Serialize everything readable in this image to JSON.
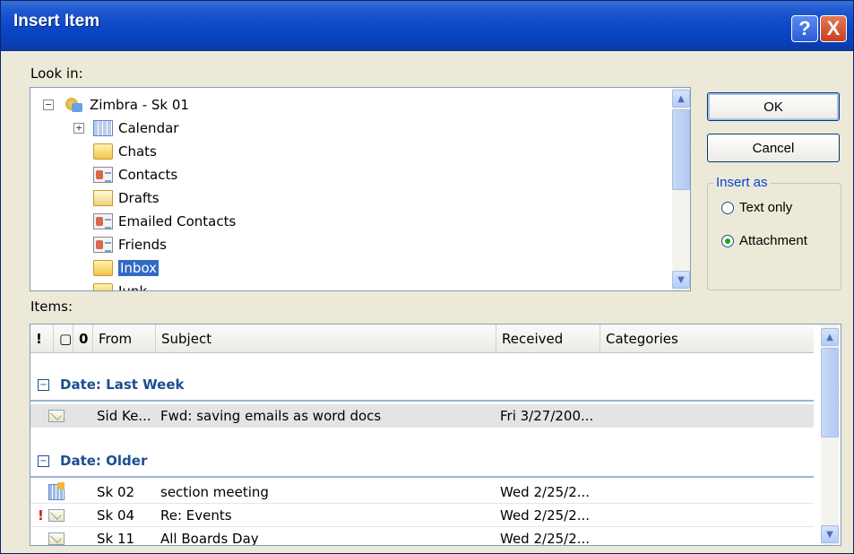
{
  "window": {
    "title": "Insert Item",
    "help_label": "?",
    "close_label": "X"
  },
  "look_in_label": "Look in:",
  "tree": {
    "root": {
      "label": "Zimbra - Sk 01",
      "expander": "−",
      "icon": "mailbox-icon"
    },
    "items": [
      {
        "label": "Calendar",
        "icon": "calendar-icon",
        "expander": "+"
      },
      {
        "label": "Chats",
        "icon": "folder-icon"
      },
      {
        "label": "Contacts",
        "icon": "contacts-icon"
      },
      {
        "label": "Drafts",
        "icon": "drafts-icon"
      },
      {
        "label": "Emailed Contacts",
        "icon": "contacts-icon"
      },
      {
        "label": "Friends",
        "icon": "contacts-icon"
      },
      {
        "label": "Inbox",
        "icon": "inbox-icon",
        "selected": true
      },
      {
        "label": "Junk",
        "icon": "folder-icon"
      }
    ]
  },
  "buttons": {
    "ok": "OK",
    "cancel": "Cancel"
  },
  "insert_as": {
    "title": "Insert as",
    "options": [
      {
        "label": "Text only",
        "selected": false
      },
      {
        "label": "Attachment",
        "selected": true
      }
    ]
  },
  "items_label": "Items:",
  "items_table": {
    "header_icons": {
      "importance": "!",
      "icon": "▢",
      "attachment": "0"
    },
    "columns": [
      "From",
      "Subject",
      "Received",
      "Categories"
    ],
    "groups": [
      {
        "title": "Date: Last Week",
        "expander": "−",
        "rows": [
          {
            "icon": "envelope-icon",
            "important": "",
            "from": "Sid Ke...",
            "subject": "Fwd: saving emails as word docs",
            "received": "Fri 3/27/200..."
          }
        ]
      },
      {
        "title": "Date: Older",
        "expander": "−",
        "rows": [
          {
            "icon": "meeting-icon",
            "important": "",
            "from": "Sk 02",
            "subject": "section meeting",
            "received": "Wed 2/25/2..."
          },
          {
            "icon": "envelope-icon",
            "important": "!",
            "from": "Sk 04",
            "subject": "Re: Events",
            "received": "Wed 2/25/2..."
          },
          {
            "icon": "envelope-icon",
            "important": "",
            "from": "Sk 11",
            "subject": "All Boards Day",
            "received": "Wed 2/25/2..."
          }
        ]
      }
    ]
  },
  "colors": {
    "title_bar": "#0a46c7",
    "selection": "#316ac5",
    "group_text": "#1b4f8f",
    "dialog_bg": "#ece9d8"
  }
}
